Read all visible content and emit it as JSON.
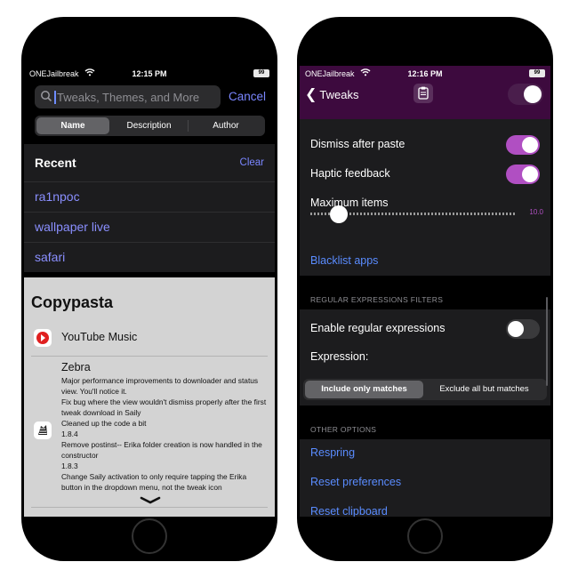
{
  "left": {
    "status": {
      "carrier": "ONEJailbreak",
      "time": "12:15 PM",
      "battery": "99"
    },
    "search": {
      "placeholder": "Tweaks, Themes, and More",
      "cancel": "Cancel"
    },
    "segments": [
      "Name",
      "Description",
      "Author"
    ],
    "segment_selected": "Name",
    "recent": {
      "title": "Recent",
      "clear": "Clear",
      "items": [
        "ra1npoc",
        "wallpaper live",
        "safari"
      ]
    },
    "sheet": {
      "title": "Copypasta",
      "app": "YouTube Music",
      "package": "Zebra",
      "changelog": [
        "Major performance improvements to downloader and status view. You'll notice it.",
        "Fix bug where the view wouldn't dismiss properly after the first tweak download in Saily",
        "Cleaned up the code a bit",
        "1.8.4",
        "Remove postinst-- Erika folder creation is now handled in the constructor",
        "1.8.3",
        "Change Saily activation to only require tapping the Erika button in the dropdown menu, not the tweak icon"
      ]
    }
  },
  "right": {
    "status": {
      "carrier": "ONEJailbreak",
      "time": "12:16 PM",
      "battery": "99"
    },
    "nav": {
      "back": "Tweaks",
      "enabled": true
    },
    "settings": {
      "dismiss_after_paste": "Dismiss after paste",
      "dismiss_after_paste_on": true,
      "haptic_feedback": "Haptic feedback",
      "haptic_feedback_on": true,
      "maximum_items": "Maximum items",
      "maximum_items_value": "10.0",
      "blacklist_apps": "Blacklist apps"
    },
    "regex": {
      "header": "REGULAR EXPRESSIONS FILTERS",
      "enable": "Enable regular expressions",
      "enable_on": false,
      "expression": "Expression:",
      "modes": [
        "Include only matches",
        "Exclude all but matches"
      ],
      "mode_selected": "Include only matches"
    },
    "other": {
      "header": "OTHER OPTIONS",
      "respring": "Respring",
      "reset_preferences": "Reset preferences",
      "reset_clipboard": "Reset clipboard"
    }
  },
  "colors": {
    "accent_purple": "#b04fc2",
    "link_blue": "#5a8cff",
    "search_blue": "#7a86ff"
  }
}
